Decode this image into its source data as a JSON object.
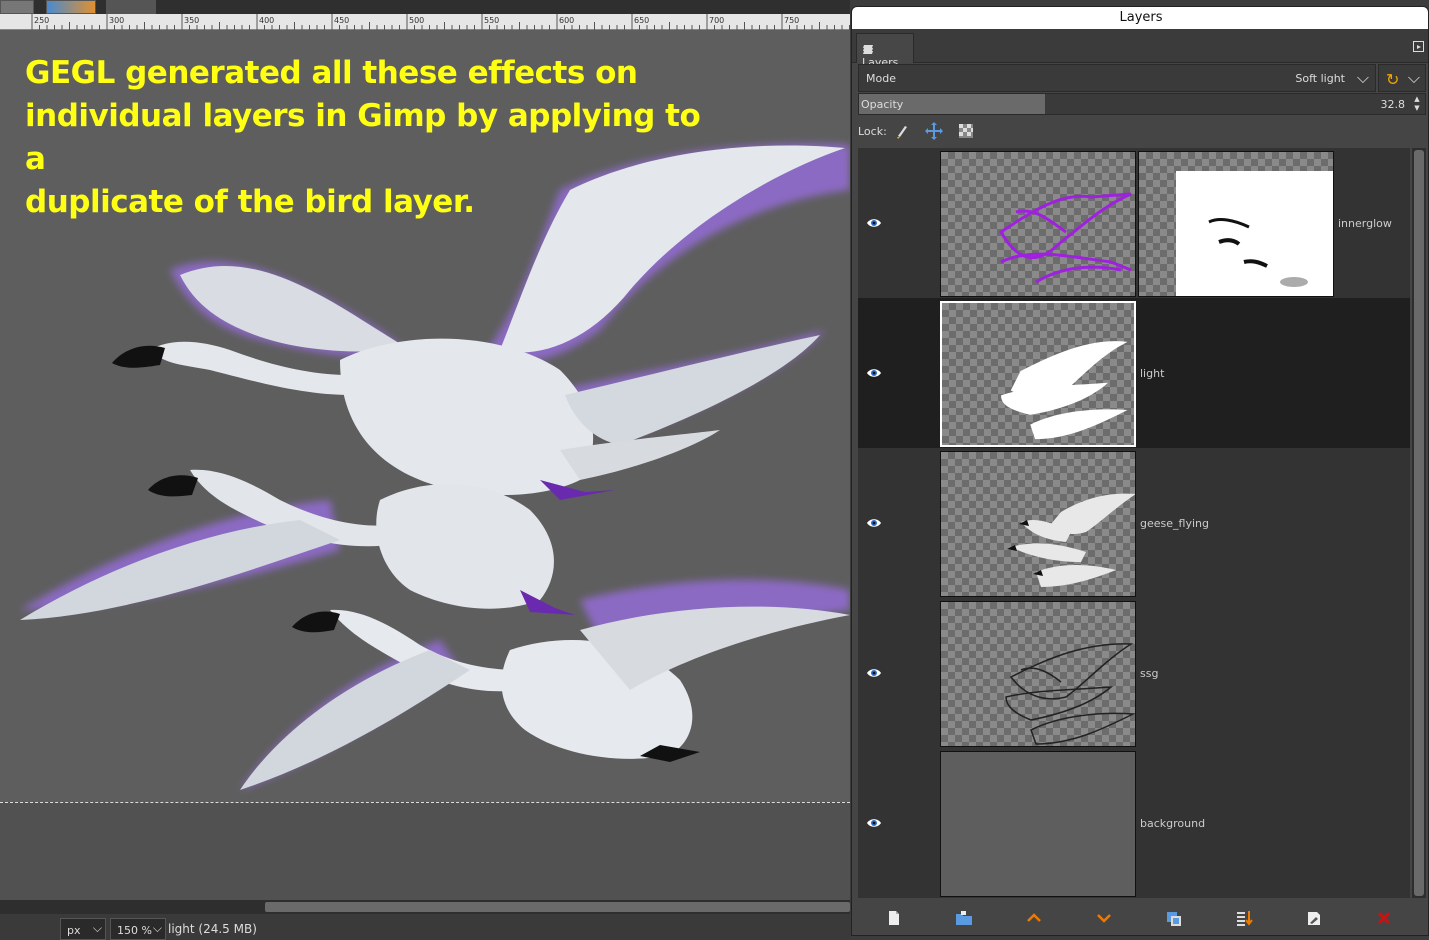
{
  "canvas": {
    "overlay_text_lines": [
      "GEGL generated all these effects on",
      "individual layers in Gimp by applying to a",
      "duplicate of the bird layer."
    ],
    "ruler_labels": [
      "250",
      "300",
      "350",
      "400",
      "450",
      "500",
      "550",
      "600",
      "650",
      "700",
      "750"
    ]
  },
  "statusbar": {
    "unit": "px",
    "zoom": "150 %",
    "status_text": "light (24.5 MB)"
  },
  "layers_dialog": {
    "window_title": "Layers",
    "tab_label": "Layers",
    "mode_label": "Mode",
    "mode_value": "Soft light",
    "opacity_label": "Opacity",
    "opacity_value": "32.8",
    "opacity_fraction": 0.328,
    "lock_label": "Lock:",
    "layers": [
      {
        "name": "innerglow",
        "visible": true,
        "selected": false,
        "has_mask": true
      },
      {
        "name": "light",
        "visible": true,
        "selected": true,
        "has_mask": false
      },
      {
        "name": "geese_flying",
        "visible": true,
        "selected": false,
        "has_mask": false
      },
      {
        "name": "ssg",
        "visible": true,
        "selected": false,
        "has_mask": false
      },
      {
        "name": "background",
        "visible": true,
        "selected": false,
        "has_mask": false
      }
    ],
    "bottom_buttons": [
      "new-layer",
      "new-layer-group",
      "raise-layer",
      "lower-layer",
      "duplicate-layer",
      "anchor-merge-layer",
      "add-mask",
      "delete-layer"
    ]
  },
  "colors": {
    "overlay_text": "#ffff14",
    "canvas_bg": "#5e5e5e",
    "accent_orange": "#f0a500",
    "delete_red": "#cc1111",
    "glow_purple": "#9b59e6"
  }
}
